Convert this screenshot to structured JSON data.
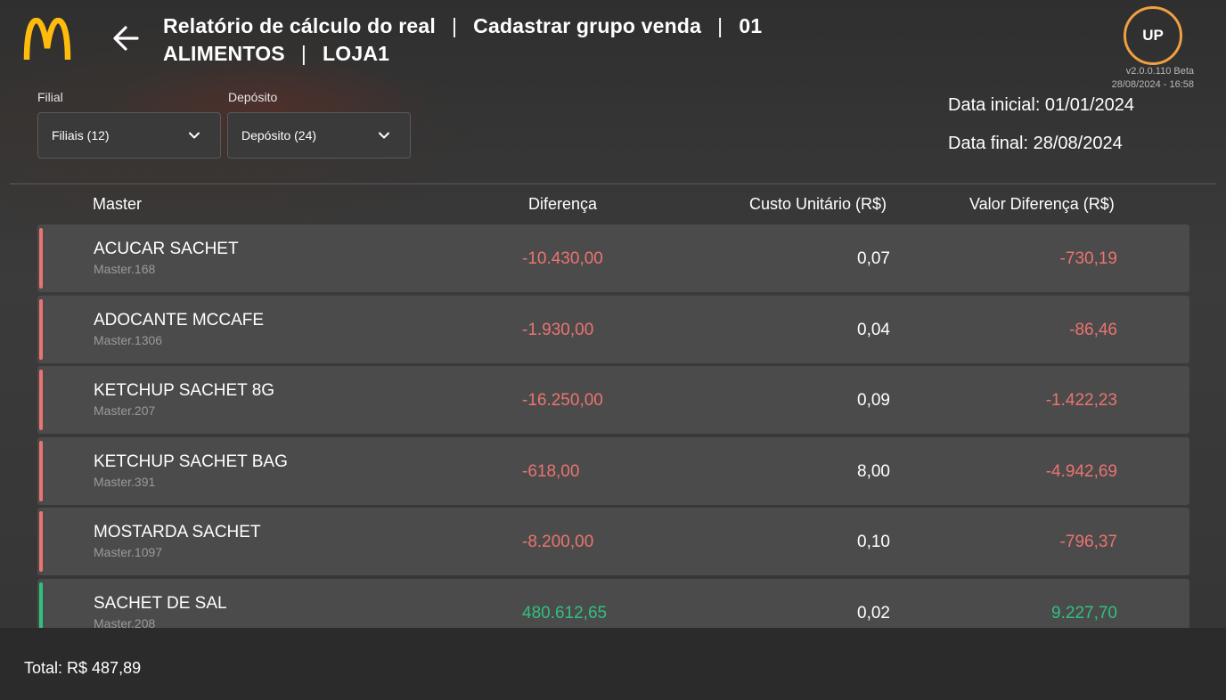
{
  "colors": {
    "negative": "#ea7470",
    "positive": "#2ec27e",
    "accent": "#f0a040",
    "logo": "#ffbc0d"
  },
  "header": {
    "logo_icon": "mcdonalds-arches-logo",
    "back_icon": "arrow-left-icon",
    "title_parts": [
      "Relatório de cálculo do real",
      "Cadastrar grupo venda",
      "01 ALIMENTOS",
      "LOJA1"
    ],
    "separator": "|",
    "avatar": "UP",
    "version": "v2.0.0.110 Beta",
    "timestamp": "28/08/2024 - 16:58"
  },
  "filters": {
    "filial": {
      "label": "Filial",
      "value": "Filiais (12)"
    },
    "deposito": {
      "label": "Depósito",
      "value": "Depósito (24)"
    },
    "data_inicial": "Data inicial: 01/01/2024",
    "data_final": "Data final: 28/08/2024"
  },
  "table": {
    "columns": [
      "Master",
      "Diferença",
      "Custo Unitário (R$)",
      "Valor Diferença (R$)"
    ],
    "rows": [
      {
        "name": "ACUCAR SACHET",
        "code": "Master.168",
        "diff": "-10.430,00",
        "cost": "0,07",
        "value": "-730,19",
        "status": "negative"
      },
      {
        "name": "ADOCANTE MCCAFE",
        "code": "Master.1306",
        "diff": "-1.930,00",
        "cost": "0,04",
        "value": "-86,46",
        "status": "negative"
      },
      {
        "name": "KETCHUP SACHET 8G",
        "code": "Master.207",
        "diff": "-16.250,00",
        "cost": "0,09",
        "value": "-1.422,23",
        "status": "negative"
      },
      {
        "name": "KETCHUP SACHET BAG",
        "code": "Master.391",
        "diff": "-618,00",
        "cost": "8,00",
        "value": "-4.942,69",
        "status": "negative"
      },
      {
        "name": "MOSTARDA SACHET",
        "code": "Master.1097",
        "diff": "-8.200,00",
        "cost": "0,10",
        "value": "-796,37",
        "status": "negative"
      },
      {
        "name": "SACHET DE SAL",
        "code": "Master.208",
        "diff": "480.612,65",
        "cost": "0,02",
        "value": "9.227,70",
        "status": "positive"
      }
    ]
  },
  "footer": {
    "total": "Total: R$  487,89"
  }
}
